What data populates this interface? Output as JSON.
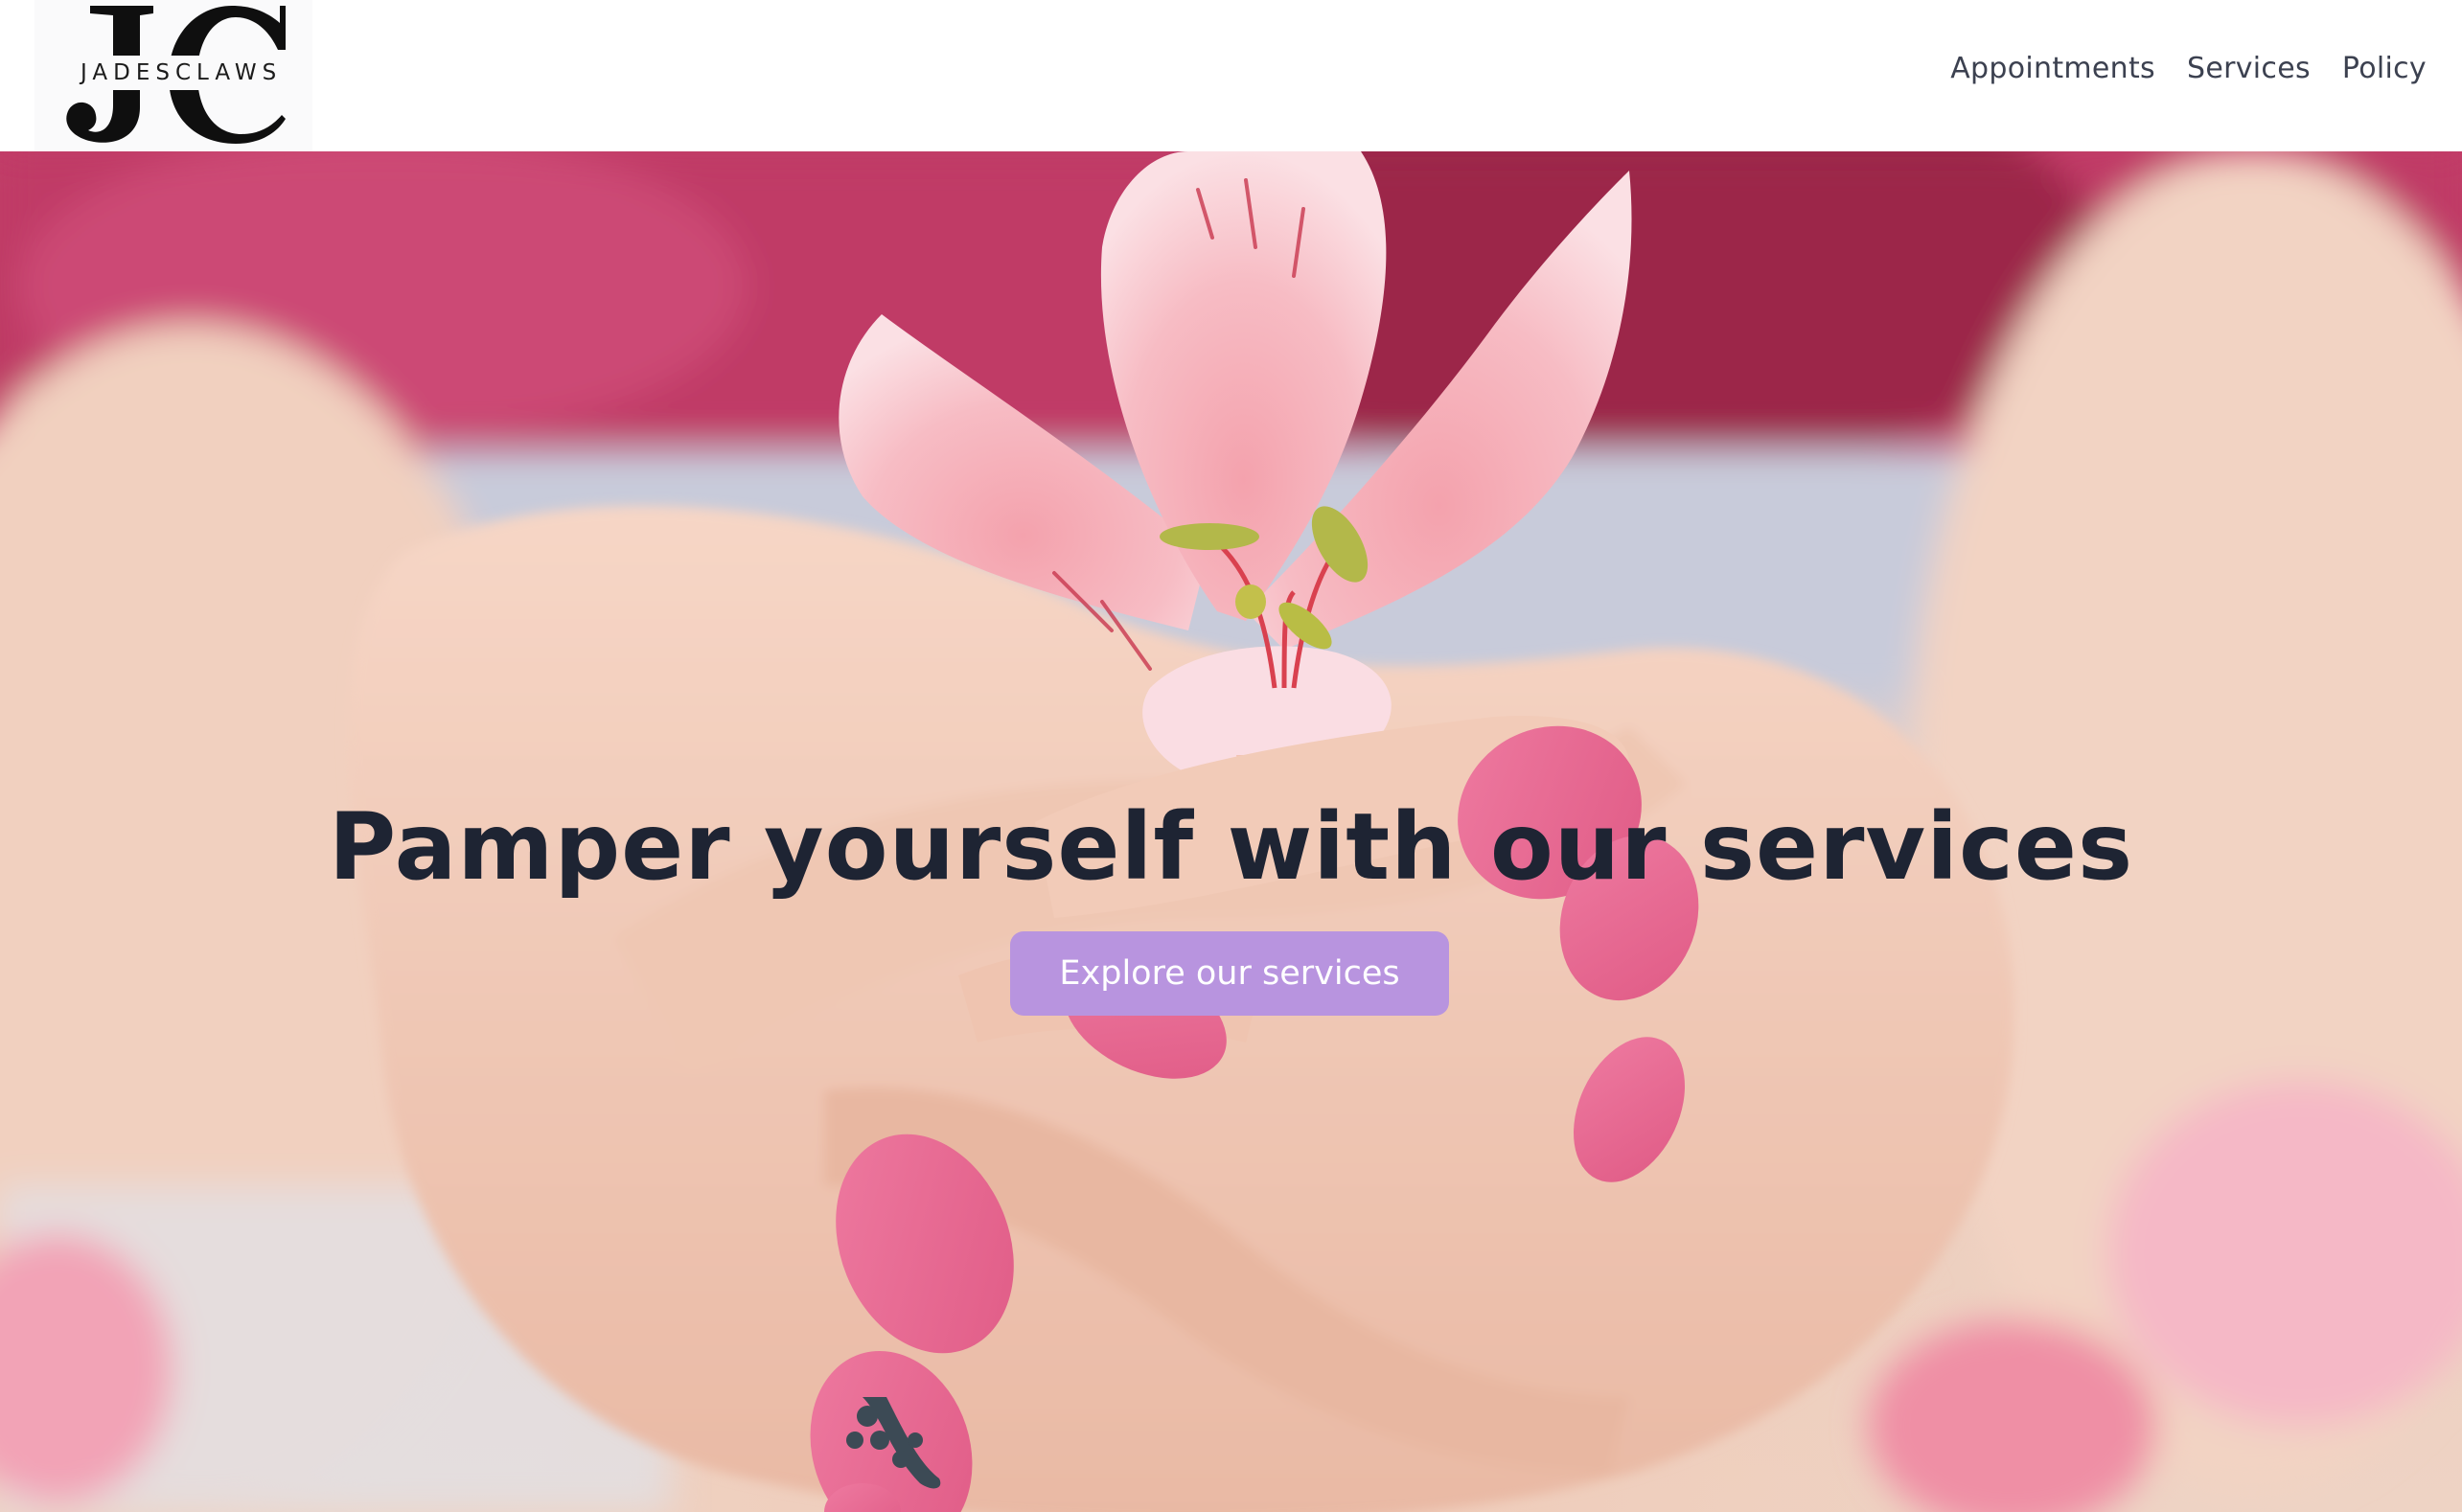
{
  "brand": {
    "monogram": "JC",
    "wordmark": "JADESCLAWS"
  },
  "nav": {
    "items": [
      {
        "label": "Appointments"
      },
      {
        "label": "Services"
      },
      {
        "label": "Policy"
      }
    ]
  },
  "hero": {
    "title": "Pamper yourself with our services",
    "cta_label": "Explore our services",
    "image_description_icon": "flower-hands-photo"
  },
  "colors": {
    "cta_background": "#b894df",
    "title_text": "#1e2433",
    "nav_text": "#3c4150",
    "nail_polish": "#e6668f"
  }
}
